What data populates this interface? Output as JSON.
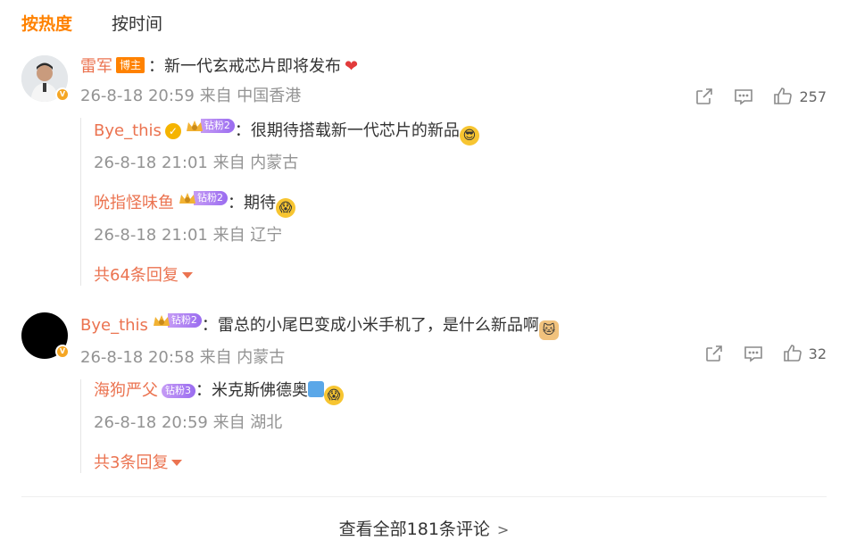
{
  "sort_tabs": {
    "hot": "按热度",
    "time": "按时间"
  },
  "comments": [
    {
      "user": "雷军",
      "tag": "博主",
      "sep": "：",
      "text": "新一代玄戒芯片即将发布",
      "meta": "26-8-18 20:59 来自 中国香港",
      "likes": "257",
      "replies": [
        {
          "user": "Bye_this",
          "fan": "钻粉2",
          "sep": "：",
          "text": "很期待搭载新一代芯片的新品",
          "meta": "26-8-18 21:01 来自 内蒙古"
        },
        {
          "user": "吮指怪味鱼",
          "fan": "钻粉2",
          "sep": "：",
          "text": "期待",
          "meta": "26-8-18 21:01 来自 辽宁"
        }
      ],
      "more": "共64条回复"
    },
    {
      "user": "Bye_this",
      "fan": "钻粉2",
      "sep": "：",
      "text": "雷总的小尾巴变成小米手机了，是什么新品啊",
      "meta": "26-8-18 20:58 来自 内蒙古",
      "likes": "32",
      "replies": [
        {
          "user": "海狗严父",
          "fan": "钻粉3",
          "sep": "：",
          "text": "米克斯佛德奥",
          "meta": "26-8-18 20:59 来自 湖北"
        }
      ],
      "more": "共3条回复"
    }
  ],
  "view_all": "查看全部181条评论",
  "colors": {
    "accent": "#ff8200",
    "username": "#eb7350",
    "meta": "#939393",
    "fan_badge": "#9a6cf0"
  }
}
